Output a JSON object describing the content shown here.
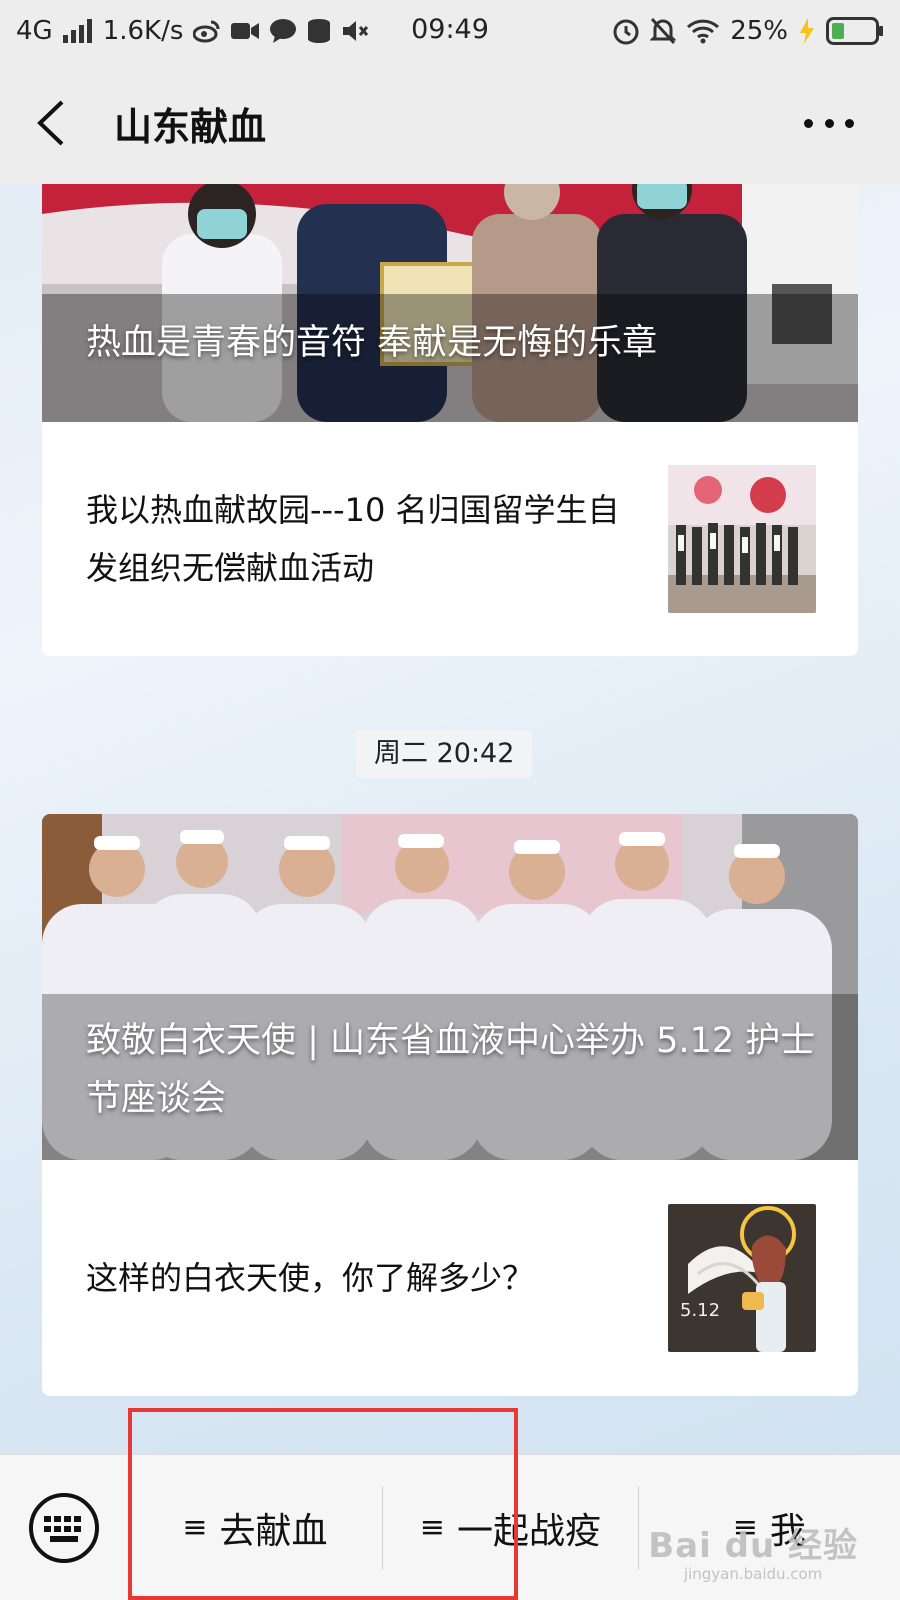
{
  "status_bar": {
    "network": "4G",
    "speed": "1.6K/s",
    "time": "09:49",
    "battery": "25%"
  },
  "header": {
    "title": "山东献血"
  },
  "feed": {
    "article1": {
      "hero_title": "热血是青春的音符 奉献是无悔的乐章",
      "sub_title": "我以热血献故园---10 名归国留学生自发组织无偿献血活动"
    },
    "timestamp": "周二 20:42",
    "article2": {
      "hero_title": "致敬白衣天使 | 山东省血液中心举办 5.12 护士节座谈会",
      "sub_title": "这样的白衣天使，你了解多少？",
      "thumb_text": "5.12"
    }
  },
  "bottom_menu": {
    "items": [
      {
        "label": "去献血",
        "icon": "menu-icon"
      },
      {
        "label": "一起战疫",
        "icon": "menu-icon"
      },
      {
        "label": "我",
        "icon": "menu-icon"
      }
    ]
  },
  "watermark": {
    "main": "Bai du 经验",
    "sub": "jingyan.baidu.com"
  },
  "colors": {
    "highlight": "#e53935",
    "bar_bg": "#ededed"
  }
}
